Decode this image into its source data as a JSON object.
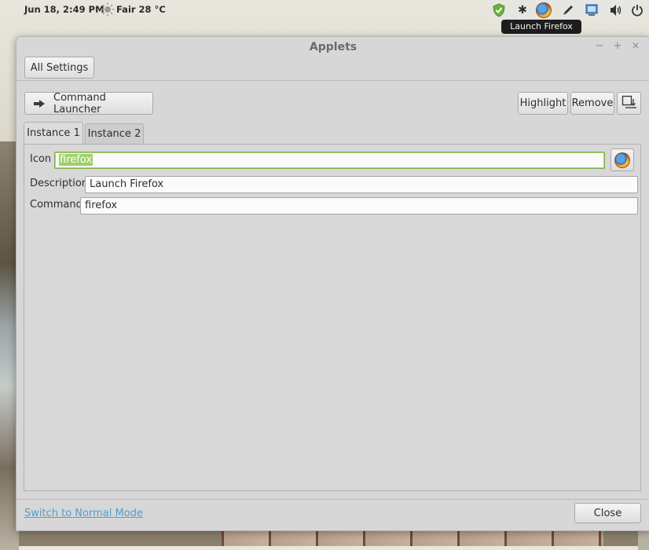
{
  "panel": {
    "datetime": "Jun 18,  2:49 PM",
    "weather": "Fair 28 °C",
    "tray_icons": [
      "shield-check-icon",
      "bluetooth-icon",
      "firefox-icon",
      "pen-icon",
      "display-icon",
      "volume-icon",
      "power-icon"
    ]
  },
  "tooltip": "Launch Firefox",
  "window": {
    "title": "Applets",
    "minimize": "−",
    "maximize": "+",
    "close_glyph": "×"
  },
  "toolbar": {
    "all_settings": "All Settings"
  },
  "applet": {
    "name": "Command Launcher",
    "highlight": "Highlight",
    "remove": "Remove"
  },
  "tabs": [
    {
      "label": "Instance 1",
      "active": true
    },
    {
      "label": "Instance 2",
      "active": false
    }
  ],
  "form": {
    "icon_label": "Icon",
    "icon_value": "firefox",
    "description_label": "Description",
    "description_value": "Launch Firefox",
    "command_label": "Command",
    "command_value": "firefox"
  },
  "footer": {
    "mode_link": "Switch to Normal Mode",
    "close": "Close"
  }
}
